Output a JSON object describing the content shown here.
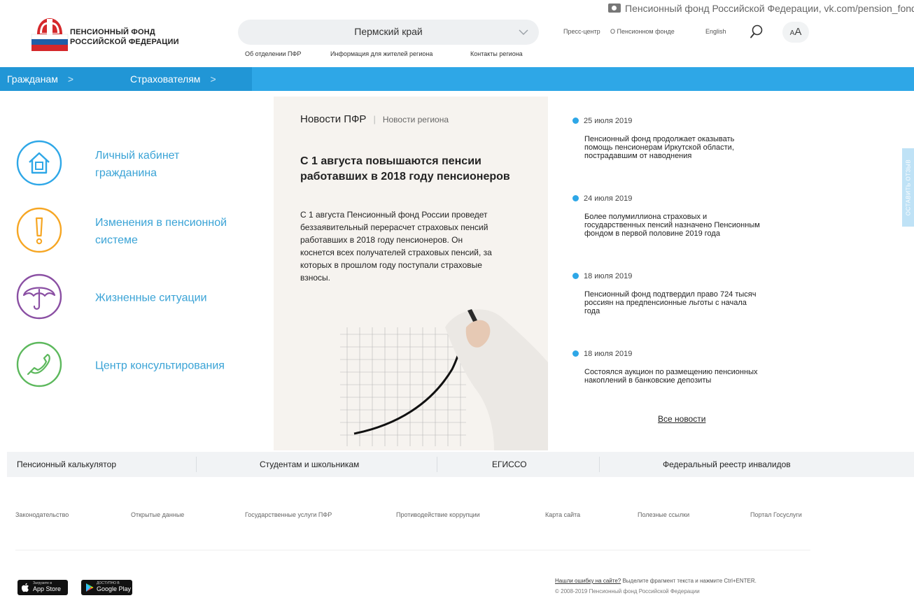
{
  "credit": "Пенсионный фонд Российской Федерации, vk.com/pension_fond",
  "logo": {
    "line1": "ПЕНСИОННЫЙ ФОНД",
    "line2": "РОССИЙСКОЙ ФЕДЕРАЦИИ",
    "colors": {
      "red": "#d5282b",
      "blue": "#1f5fa8"
    }
  },
  "region": {
    "value": "Пермский край",
    "icon": "chevron-down-icon"
  },
  "region_links": [
    "Об отделении ПФР",
    "Информация для жителей региона",
    "Контакты региона"
  ],
  "top_links": [
    "Пресс-центр",
    "О Пенсионном фонде",
    "English"
  ],
  "font_size_toggle": {
    "small": "A",
    "large": "A"
  },
  "nav": {
    "items": [
      "Гражданам",
      "Страхователям"
    ],
    "colors": {
      "bar": "#2ea7e7",
      "active": "#2196d6"
    }
  },
  "services": [
    {
      "title_line1": "Личный кабинет",
      "title_line2": "гражданина",
      "icon": "house-icon",
      "color": "#2ea7e7"
    },
    {
      "title_line1": "Изменения в пенсионной",
      "title_line2": "системе",
      "icon": "exclamation-icon",
      "color": "#f6a623"
    },
    {
      "title_line1": "Жизненные ситуации",
      "title_line2": "",
      "icon": "umbrella-icon",
      "color": "#8a4fa3"
    },
    {
      "title_line1": "Центр консультирования",
      "title_line2": "",
      "icon": "phone-icon",
      "color": "#5cb85c"
    }
  ],
  "news_tabs": {
    "active": "Новости ПФР",
    "inactive": "Новости региона"
  },
  "featured": {
    "headline_line1": "С 1 августа повышаются пенсии",
    "headline_line2": "работавших в 2018 году пенсионеров",
    "body": [
      "С 1 августа Пенсионный фонд России проведет",
      "беззаявительный перерасчет страховых пенсий",
      "работавших в 2018 году пенсионеров. Он",
      "коснется всех получателей страховых пенсий, за",
      "которых в прошлом году поступали страховые",
      "взносы."
    ]
  },
  "news": [
    {
      "date": "25 июля 2019",
      "lines": [
        "Пенсионный фонд продолжает оказывать",
        "помощь пенсионерам Иркутской области,",
        "пострадавшим от наводнения"
      ]
    },
    {
      "date": "24 июля 2019",
      "lines": [
        "Более полумиллиона страховых и",
        "государственных пенсий назначено Пенсионным",
        "фондом в первой половине 2019 года"
      ]
    },
    {
      "date": "18 июля 2019",
      "lines": [
        "Пенсионный фонд подтвердил право 724 тысяч",
        "россиян на предпенсионные льготы с начала",
        "года"
      ]
    },
    {
      "date": "18 июля 2019",
      "lines": [
        "Состоялся аукцион по размещению пенсионных",
        "накоплений в банковские депозиты"
      ]
    }
  ],
  "all_news": "Все новости",
  "side_tab": "ОСТАВИТЬ ОТЗЫВ",
  "bottom_bar": [
    "Пенсионный калькулятор",
    "Студентам и школьникам",
    "ЕГИССО",
    "Федеральный реестр инвалидов"
  ],
  "footer_links": [
    "Законодательство",
    "Открытые данные",
    "Государственные услуги ПФР",
    "Противодействие коррупции",
    "Карта сайта",
    "Полезные ссылки",
    "Портал Госуслуги"
  ],
  "badges": {
    "appstore": {
      "small": "Загрузите в",
      "big": "App Store"
    },
    "googleplay": {
      "small": "ДОСТУПНО В",
      "big": "Google Play"
    }
  },
  "error_notice": {
    "link": "Нашли ошибку на сайте?",
    "text": " Выделите фрагмент текста и нажмите Ctrl+ENTER."
  },
  "copyright": "© 2008-2019 Пенсионный фонд Российской Федерации"
}
